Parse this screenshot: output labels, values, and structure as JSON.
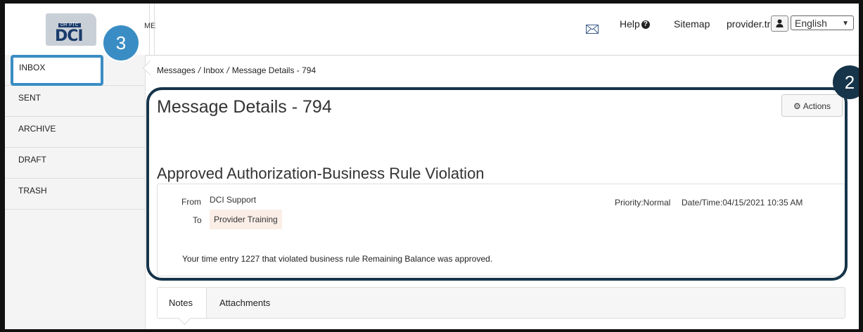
{
  "header": {
    "logo_tag": "OR PTC",
    "logo_text": "DCI",
    "home_fragment": "ME",
    "help_label": "Help",
    "sitemap_label": "Sitemap",
    "user_label": "provider.tra...",
    "language": "English"
  },
  "callouts": {
    "sidebar_step": "3",
    "details_step": "2"
  },
  "sidebar": {
    "items": [
      {
        "label": "INBOX"
      },
      {
        "label": "SENT"
      },
      {
        "label": "ARCHIVE"
      },
      {
        "label": "DRAFT"
      },
      {
        "label": "TRASH"
      }
    ]
  },
  "breadcrumb": {
    "items": [
      "Messages",
      "Inbox",
      "Message Details - 794"
    ],
    "separator": "/"
  },
  "message": {
    "page_title": "Message Details - 794",
    "actions_label": "Actions",
    "subject": "Approved Authorization-Business Rule Violation",
    "from_label": "From",
    "from_value": "DCI Support",
    "to_label": "To",
    "to_value": "Provider Training",
    "priority": "Priority:Normal",
    "datetime": "Date/Time:04/15/2021 10:35 AM",
    "body": "Your time entry 1227 that violated business rule Remaining Balance was approved."
  },
  "tabs": [
    {
      "label": "Notes"
    },
    {
      "label": "Attachments"
    }
  ],
  "colors": {
    "callout_blue": "#3a8dc4",
    "callout_navy": "#16344a",
    "to_bg": "#fbeee7"
  }
}
